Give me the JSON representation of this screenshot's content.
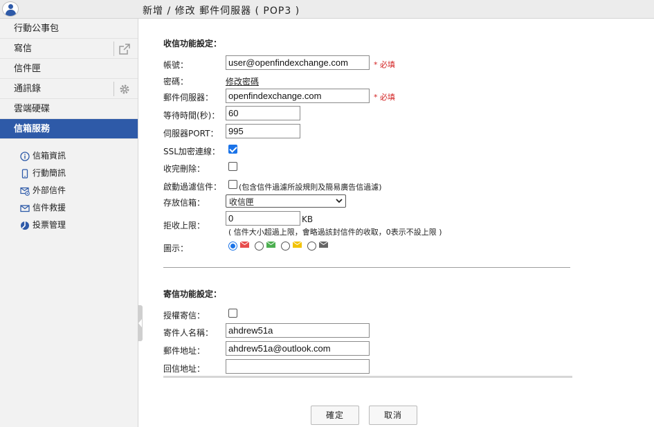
{
  "header": {
    "title": "新增 / 修改 郵件伺服器 ( POP3 )"
  },
  "sidebar": {
    "items": [
      {
        "label": "行動公事包"
      },
      {
        "label": "寫信"
      },
      {
        "label": "信件匣"
      },
      {
        "label": "通訊錄"
      },
      {
        "label": "雲端硬碟"
      },
      {
        "label": "信箱服務"
      }
    ],
    "sub_items": [
      {
        "label": "信箱資訊",
        "icon": "info-icon"
      },
      {
        "label": "行動簡訊",
        "icon": "mobile-icon"
      },
      {
        "label": "外部信件",
        "icon": "external-mail-icon"
      },
      {
        "label": "信件救援",
        "icon": "mail-rescue-icon"
      },
      {
        "label": "投票管理",
        "icon": "vote-icon"
      }
    ]
  },
  "receive": {
    "section_title": "收信功能設定：",
    "account_label": "帳號：",
    "account_value": "user@openfindexchange.com",
    "required_text": "* 必填",
    "password_label": "密碼：",
    "password_link": "修改密碼",
    "server_label": "郵件伺服器：",
    "server_value": "openfindexchange.com",
    "timeout_label": "等待時間(秒)：",
    "timeout_value": "60",
    "port_label": "伺服器PORT：",
    "port_value": "995",
    "ssl_label": "SSL加密連線：",
    "ssl_checked": true,
    "delete_label": "收完刪除：",
    "delete_checked": false,
    "filter_label": "啟動過濾信件：",
    "filter_checked": false,
    "filter_note": "(包含信件過濾所設規則及簡易廣告信過濾)",
    "folder_label": "存放信箱：",
    "folder_value": "收信匣",
    "limit_label": "拒收上限：",
    "limit_value": "0",
    "limit_unit": "KB",
    "limit_note": "( 信件大小超過上限，會略過該封信件的收取，0表示不設上限 )",
    "icon_label": "圖示：",
    "icon_options": [
      {
        "color": "#e74c4c",
        "checked": true
      },
      {
        "color": "#4caf50",
        "checked": false
      },
      {
        "color": "#f2c200",
        "checked": false
      },
      {
        "color": "#666666",
        "checked": false
      }
    ]
  },
  "send": {
    "section_title": "寄信功能設定：",
    "auth_label": "授權寄信：",
    "auth_checked": false,
    "sender_name_label": "寄件人名稱：",
    "sender_name_value": "ahdrew51a",
    "address_label": "郵件地址：",
    "address_value": "ahdrew51a@outlook.com",
    "reply_label": "回信地址：",
    "reply_value": ""
  },
  "buttons": {
    "confirm": "確定",
    "cancel": "取消"
  },
  "colors": {
    "accent": "#2e5aa8",
    "required": "#d21f1f",
    "checkbox": "#1a73e8"
  }
}
